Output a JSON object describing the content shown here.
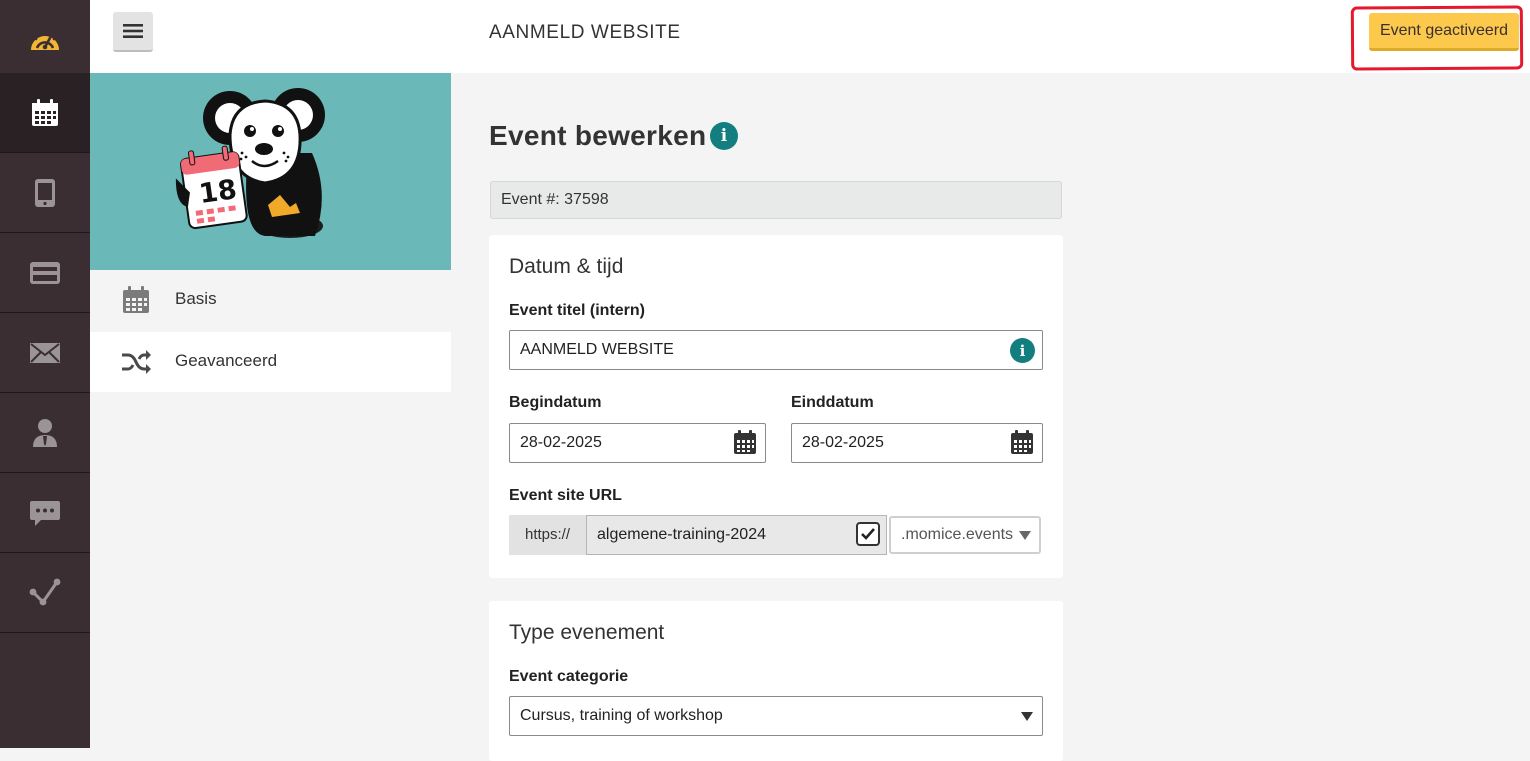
{
  "header": {
    "title": "AANMELD WEBSITE",
    "status_button": "Event geactiveerd"
  },
  "rail": {
    "items": [
      {
        "icon": "speedometer-icon"
      },
      {
        "icon": "calendar-icon",
        "active": true
      },
      {
        "icon": "mobile-phone-icon"
      },
      {
        "icon": "credit-card-icon"
      },
      {
        "icon": "envelope-icon"
      },
      {
        "icon": "user-tie-icon"
      },
      {
        "icon": "chat-bubble-icon"
      },
      {
        "icon": "analytics-icon"
      }
    ]
  },
  "subnav": {
    "items": [
      {
        "label": "Basis",
        "icon": "calendar-icon",
        "active": false
      },
      {
        "label": "Geavanceerd",
        "icon": "shuffle-icon",
        "active": true
      }
    ]
  },
  "hero": {
    "calendar_number": "18"
  },
  "main": {
    "title": "Event bewerken",
    "event_id": "Event #: 37598",
    "date_card": {
      "title": "Datum & tijd",
      "event_title_label": "Event titel (intern)",
      "event_title_value": "AANMELD WEBSITE",
      "begin_label": "Begindatum",
      "begin_value": "28-02-2025",
      "end_label": "Einddatum",
      "end_value": "28-02-2025",
      "url_label": "Event site URL",
      "url_prefix": "https://",
      "url_value": "algemene-training-2024",
      "url_checked": true,
      "domain_value": ".momice.events"
    },
    "type_card": {
      "title": "Type evenement",
      "category_label": "Event categorie",
      "category_value": "Cursus, training of workshop"
    }
  },
  "colors": {
    "rail_bg": "#3a2e33",
    "accent_teal": "#127e80",
    "hero_bg": "#6bb8b9",
    "activate_yellow": "#fcc94d",
    "annotation_red": "#e5192d"
  }
}
